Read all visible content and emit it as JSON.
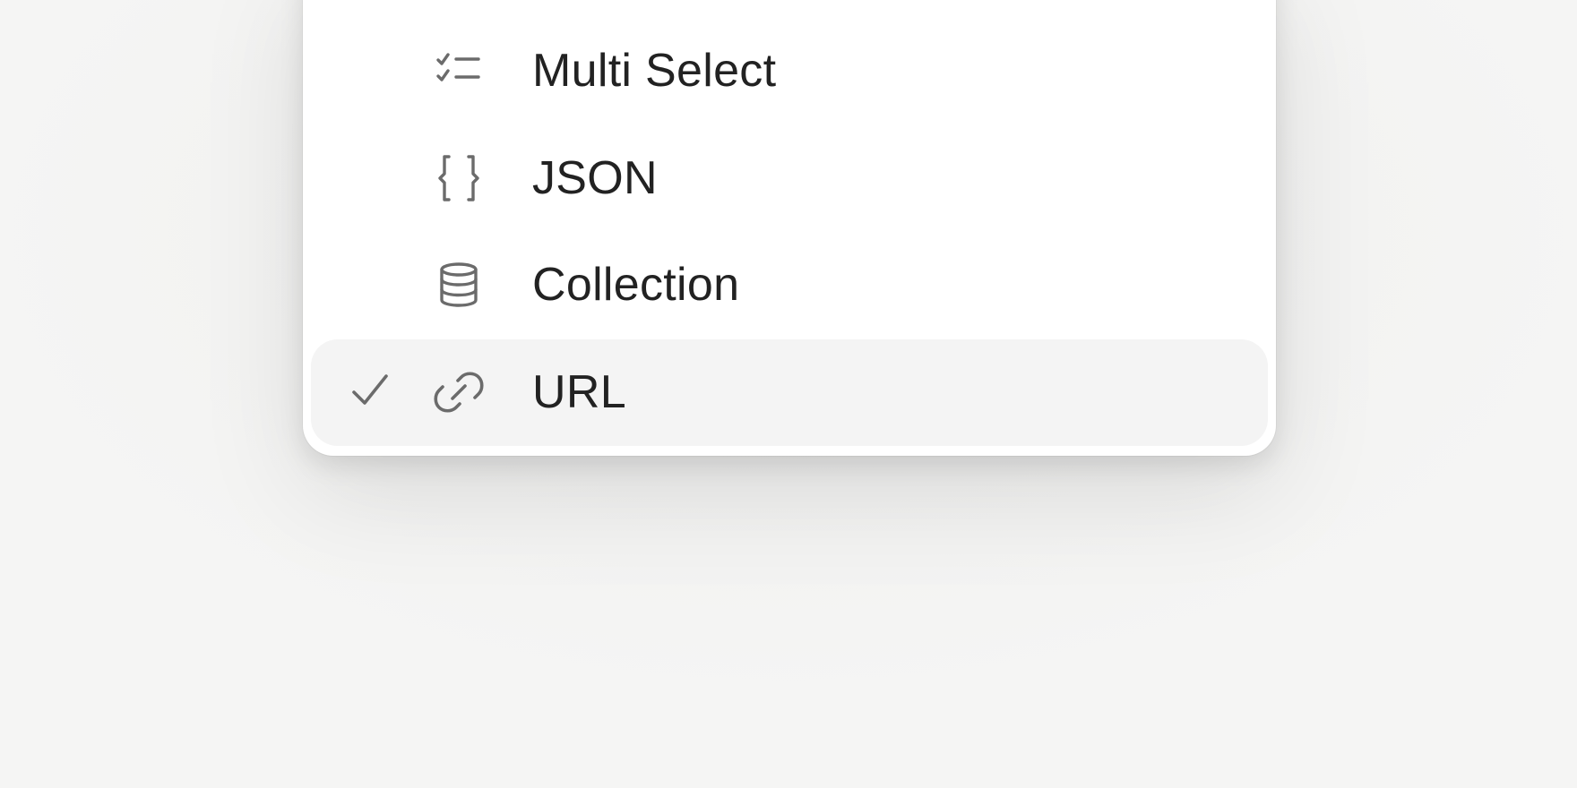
{
  "menu": {
    "items": [
      {
        "label": "Multi Select",
        "icon": "checklist-icon",
        "selected": false
      },
      {
        "label": "JSON",
        "icon": "braces-icon",
        "selected": false
      },
      {
        "label": "Collection",
        "icon": "database-icon",
        "selected": false
      },
      {
        "label": "URL",
        "icon": "link-icon",
        "selected": true
      }
    ]
  },
  "colors": {
    "background": "#f4f4f3",
    "menu_background": "#ffffff",
    "selected_row": "#f4f4f4",
    "text": "#222222",
    "icon": "#6b6b6b"
  }
}
